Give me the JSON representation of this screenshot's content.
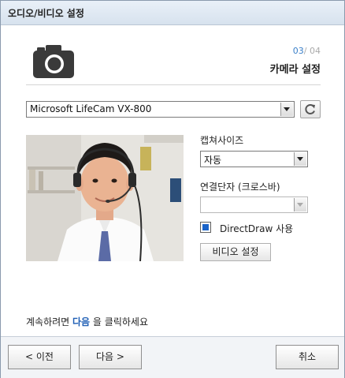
{
  "window": {
    "title": "오디오/비디오 설정"
  },
  "header": {
    "step_current": "03",
    "step_sep": "/",
    "step_total": "04",
    "page_title": "카메라 설정",
    "icon": "camera-icon"
  },
  "device": {
    "selected": "Microsoft LifeCam VX-800",
    "refresh_icon": "refresh-icon"
  },
  "preview": {
    "description_icon": "webcam-preview"
  },
  "capture_size": {
    "label": "캡쳐사이즈",
    "selected": "자동"
  },
  "connector": {
    "label": "연결단자 (크로스바)",
    "selected": ""
  },
  "directdraw": {
    "label": "DirectDraw 사용",
    "checked": true
  },
  "video_settings_button": "비디오 설정",
  "instruction": {
    "before": "계속하려면 ",
    "highlight": "다음",
    "after": " 을 클릭하세요"
  },
  "footer": {
    "prev_label": "< 이전",
    "next_label": "다음 >",
    "cancel_label": "취소"
  },
  "colors": {
    "accent": "#1f5fb5",
    "checkbox_fill": "#1a63c9",
    "step_current": "#3a7fc8"
  }
}
